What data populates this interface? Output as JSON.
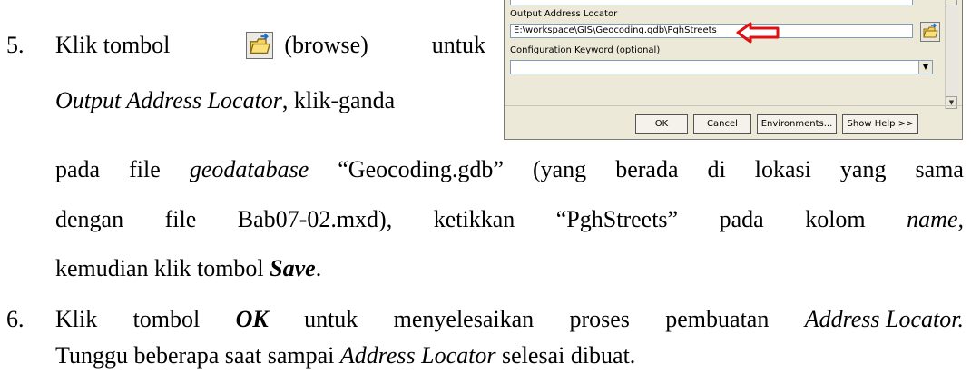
{
  "dialog": {
    "output_label": "Output Address Locator",
    "output_value": "E:\\workspace\\GIS\\Geocoding.gdb\\PghStreets",
    "config_label": "Configuration Keyword (optional)",
    "config_value": "",
    "buttons": {
      "ok": "OK",
      "cancel": "Cancel",
      "environments": "Environments...",
      "show_help": "Show Help >>"
    },
    "arrow_color": "#e01010"
  },
  "step5": {
    "number": "5.",
    "l1_a": "Klik tombol",
    "l1_b": "(browse)",
    "l1_c": "untuk",
    "l2_a": "Output Address Locator",
    "l2_b": ", klik-ganda",
    "l3": [
      "pada",
      "file",
      "geodatabase",
      "“Geocoding.gdb”",
      "(yang",
      "berada",
      "di",
      "lokasi",
      "yang",
      "sama"
    ],
    "l4": [
      "dengan",
      "file",
      "Bab07-02.mxd),",
      "ketikkan",
      "“PghStreets”",
      "pada",
      "kolom",
      "name,"
    ],
    "l5_a": "kemudian klik tombol ",
    "l5_b": "Save",
    "l5_c": "."
  },
  "step6": {
    "number": "6.",
    "l1": [
      "Klik",
      "tombol",
      "OK",
      "untuk",
      "menyelesaikan",
      "proses",
      "pembuatan",
      "Address Locator."
    ],
    "l2_a": "Tunggu beberapa saat sampai ",
    "l2_b": "Address Locator",
    "l2_c": " selesai dibuat."
  }
}
